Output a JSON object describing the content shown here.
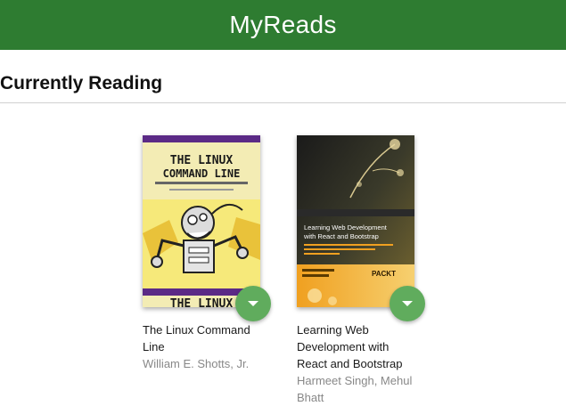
{
  "header": {
    "title": "MyReads",
    "color": "#2e7c31"
  },
  "shelf": {
    "title": "Currently Reading",
    "books": [
      {
        "title": "The Linux Command Line",
        "authors": "William E. Shotts, Jr.",
        "cover_text": {
          "line1": "THE LINUX",
          "line2": "COMMAND LINE",
          "bottom": "THE LINUX"
        },
        "shelf_changer_icon": "chevron-down-icon"
      },
      {
        "title": "Learning Web Development with React and Bootstrap",
        "authors": "Harmeet Singh, Mehul Bhatt",
        "cover_text": {
          "line1": "Learning Web Development",
          "line2": "with React and Bootstrap",
          "publisher": "PACKT"
        },
        "shelf_changer_icon": "chevron-down-icon"
      }
    ]
  },
  "colors": {
    "shelf_changer": "#60ac5d",
    "author_text": "#888888"
  }
}
